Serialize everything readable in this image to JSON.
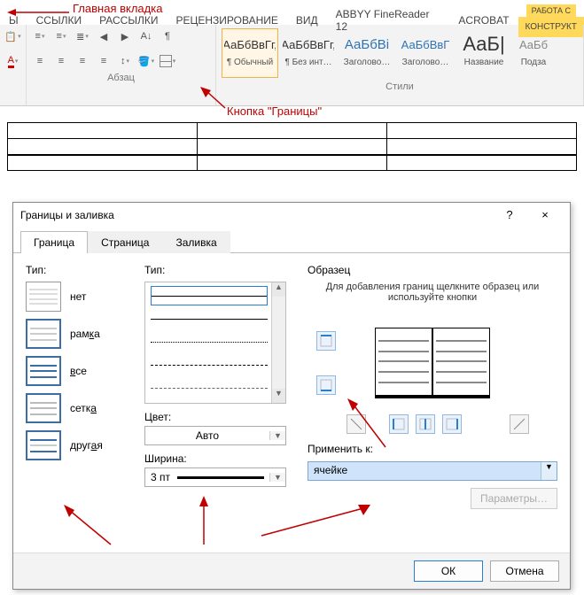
{
  "annotations": {
    "main_tab": "Главная вкладка",
    "borders_btn": "Кнопка \"Границы\""
  },
  "tabs": {
    "t1": "Ы",
    "t2": "ССЫЛКИ",
    "t3": "РАССЫЛКИ",
    "t4": "РЕЦЕНЗИРОВАНИЕ",
    "t5": "ВИД",
    "t6": "ABBYY FineReader 12",
    "t7": "ACROBAT",
    "ctx_title": "РАБОТА С",
    "ctx_tab": "КОНСТРУКТ"
  },
  "ribbon": {
    "paragraph": "Абзац",
    "styles": "Стили"
  },
  "gallery": {
    "s1_prev": "АаБбВвГг,",
    "s1_name": "¶ Обычный",
    "s2_prev": "АаБбВвГг,",
    "s2_name": "¶ Без инт…",
    "s3_prev": "АаБбВі",
    "s3_name": "Заголово…",
    "s4_prev": "АаБбВвГ",
    "s4_name": "Заголово…",
    "s5_prev": "АаБ|",
    "s5_name": "Название",
    "s6_prev": "АаБб",
    "s6_name": "Подза"
  },
  "dialog": {
    "title": "Границы и заливка",
    "help": "?",
    "close": "×",
    "tab1": "Граница",
    "tab2": "Страница",
    "tab3": "Заливка",
    "type_label": "Тип:",
    "type_none": "нет",
    "type_box": "рамка",
    "type_all": "все",
    "type_grid": "сетка",
    "type_other": "другая",
    "style_label": "Тип:",
    "color_label": "Цвет:",
    "color_val": "Авто",
    "width_label": "Ширина:",
    "width_val": "3 пт",
    "preview_label": "Образец",
    "preview_help": "Для добавления границ щелкните образец или используйте кнопки",
    "apply_label": "Применить к:",
    "apply_val": "ячейке",
    "params": "Параметры…",
    "ok": "ОК",
    "cancel": "Отмена"
  }
}
